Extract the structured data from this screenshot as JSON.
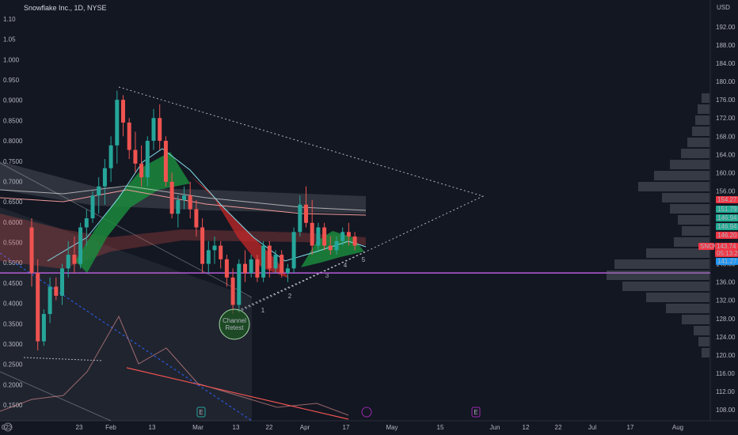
{
  "header": {
    "title": "Snowflake Inc., 1D, NYSE"
  },
  "chart_data": {
    "type": "candlestick",
    "currency": "USD",
    "right_axis": {
      "ticks": [
        "192.00",
        "188.00",
        "184.00",
        "180.00",
        "176.00",
        "172.00",
        "168.00",
        "164.00",
        "160.00",
        "156.00",
        "152.00",
        "148.00",
        "144.00",
        "140.00",
        "136.00",
        "132.00",
        "128.00",
        "124.00",
        "120.00",
        "116.00",
        "112.00",
        "108.00"
      ]
    },
    "left_axis": {
      "ticks": [
        "1.10",
        "1.05",
        "1.000",
        "0.950",
        "0.9000",
        "0.8500",
        "0.8000",
        "0.7500",
        "0.7000",
        "0.6500",
        "0.6000",
        "0.5500",
        "0.5000",
        "0.4500",
        "0.4000",
        "0.3500",
        "0.3000",
        "0.2500",
        "0.2000",
        "0.1500"
      ]
    },
    "x_axis": {
      "ticks": [
        "023",
        "23",
        "Feb",
        "13",
        "Mar",
        "13",
        "22",
        "Apr",
        "17",
        "May",
        "15",
        "Jun",
        "12",
        "22",
        "Jul",
        "17",
        "Aug"
      ]
    },
    "candles": [
      [
        0,
        148,
        150,
        135,
        138
      ],
      [
        1,
        138,
        141,
        121,
        123
      ],
      [
        2,
        123,
        130,
        122,
        129
      ],
      [
        3,
        129,
        137,
        127,
        135
      ],
      [
        4,
        135,
        137,
        132,
        133
      ],
      [
        5,
        133,
        140,
        131,
        139
      ],
      [
        6,
        139,
        145,
        137,
        142
      ],
      [
        7,
        142,
        146,
        138,
        140
      ],
      [
        8,
        140,
        149,
        139,
        148
      ],
      [
        9,
        148,
        152,
        144,
        150
      ],
      [
        10,
        150,
        156,
        149,
        155
      ],
      [
        11,
        155,
        159,
        151,
        157
      ],
      [
        12,
        157,
        163,
        153,
        161
      ],
      [
        13,
        161,
        168,
        158,
        166
      ],
      [
        14,
        166,
        178,
        162,
        176
      ],
      [
        15,
        176,
        177,
        168,
        171
      ],
      [
        16,
        171,
        172,
        163,
        165
      ],
      [
        17,
        165,
        169,
        160,
        162
      ],
      [
        18,
        162,
        166,
        157,
        159
      ],
      [
        19,
        159,
        168,
        157,
        167
      ],
      [
        20,
        167,
        174,
        165,
        172
      ],
      [
        21,
        172,
        175,
        165,
        167
      ],
      [
        22,
        167,
        168,
        157,
        158
      ],
      [
        23,
        158,
        160,
        150,
        151
      ],
      [
        24,
        151,
        155,
        148,
        154
      ],
      [
        25,
        154,
        157,
        152,
        155
      ],
      [
        26,
        155,
        158,
        150,
        152
      ],
      [
        27,
        152,
        154,
        146,
        148
      ],
      [
        28,
        148,
        150,
        138,
        140
      ],
      [
        29,
        140,
        145,
        138,
        143
      ],
      [
        30,
        143,
        146,
        140,
        144
      ],
      [
        31,
        144,
        145,
        139,
        141
      ],
      [
        32,
        141,
        142,
        135,
        137
      ],
      [
        33,
        137,
        139,
        129,
        131
      ],
      [
        34,
        131,
        141,
        130,
        140
      ],
      [
        35,
        140,
        143,
        136,
        138
      ],
      [
        36,
        138,
        142,
        137,
        141
      ],
      [
        37,
        141,
        142,
        136,
        137
      ],
      [
        38,
        137,
        145,
        136,
        144
      ],
      [
        39,
        144,
        145,
        137,
        139
      ],
      [
        40,
        139,
        143,
        138,
        142
      ],
      [
        41,
        142,
        143,
        137,
        138
      ],
      [
        42,
        138,
        140,
        136,
        139
      ],
      [
        43,
        139,
        148,
        138,
        147
      ],
      [
        44,
        147,
        155,
        146,
        153
      ],
      [
        45,
        153,
        157,
        148,
        149
      ],
      [
        46,
        149,
        154,
        142,
        144
      ],
      [
        47,
        144,
        149,
        143,
        148
      ],
      [
        48,
        148,
        149,
        143,
        144
      ],
      [
        49,
        144,
        146,
        142,
        143
      ],
      [
        50,
        143,
        146,
        142,
        145
      ],
      [
        51,
        145,
        148,
        144,
        147
      ],
      [
        52,
        147,
        149,
        144,
        146
      ],
      [
        53,
        146,
        147,
        143,
        144
      ]
    ],
    "wave_labels": [
      "1",
      "2",
      "3",
      "4",
      "5"
    ],
    "annotation": "Channel Retest",
    "horizontal_level": 138.0,
    "price_tags": [
      {
        "value": "154.27",
        "color": "#f23645"
      },
      {
        "value": "151.79",
        "color": "#22ab94"
      },
      {
        "value": "146.94",
        "color": "#22ab94"
      },
      {
        "value": "146.94",
        "color": "#22ab94"
      },
      {
        "value": "146.20",
        "color": "#f23645"
      },
      {
        "value": "SNOW",
        "color": "#f23645"
      },
      {
        "value": "143.74",
        "color": "#f23645"
      },
      {
        "value": "05:13:26",
        "color": "#f23645"
      },
      {
        "value": "141.27",
        "color": "#2196f3"
      }
    ],
    "event_markers": [
      "E",
      "E"
    ],
    "colors": {
      "up": "#26a69a",
      "down": "#ef5350",
      "level": "#b45dd8",
      "background": "#131722"
    }
  }
}
